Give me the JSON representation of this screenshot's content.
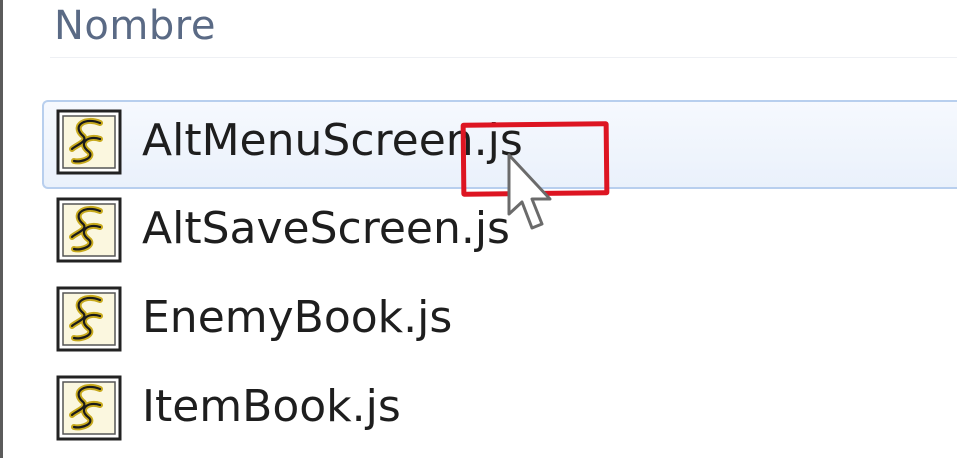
{
  "header": {
    "name_column_label": "Nombre"
  },
  "files": [
    {
      "name": "AltMenuScreen.js",
      "icon": "script-file-icon",
      "selected": true
    },
    {
      "name": "AltSaveScreen.js",
      "icon": "script-file-icon",
      "selected": false
    },
    {
      "name": "EnemyBook.js",
      "icon": "script-file-icon",
      "selected": false
    },
    {
      "name": "ItemBook.js",
      "icon": "script-file-icon",
      "selected": false
    }
  ],
  "colors": {
    "header_text": "#5a6a85",
    "selection_border": "#b8cfee",
    "annotation_red": "#dd1522"
  }
}
